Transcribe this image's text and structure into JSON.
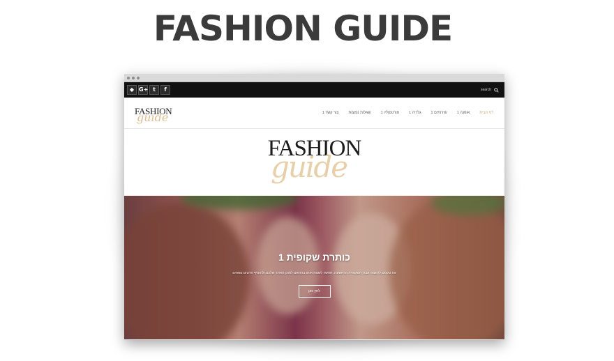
{
  "promo": {
    "title": "FASHION GUIDE"
  },
  "window": {
    "chrome_dots": 3
  },
  "topbar": {
    "social": [
      {
        "icon": "android-icon",
        "glyph": "◆"
      },
      {
        "icon": "google-plus-icon",
        "glyph": "G+"
      },
      {
        "icon": "twitter-icon",
        "glyph": "t"
      },
      {
        "icon": "facebook-icon",
        "glyph": "f"
      }
    ],
    "search_label": "search"
  },
  "nav": {
    "logo_top": "FASHION",
    "logo_bottom": "guide",
    "items": [
      {
        "label": "דף הבית",
        "active": true
      },
      {
        "label": "אופנה 1"
      },
      {
        "label": "שירותים 1"
      },
      {
        "label": "גלריה 1"
      },
      {
        "label": "פורטפוליו 1"
      },
      {
        "label": "שאלות נפוצות"
      },
      {
        "label": "צור קשר 1"
      }
    ]
  },
  "hero_logo": {
    "top": "FASHION",
    "bottom": "guide"
  },
  "hero": {
    "title": "כותרת שקופית 1",
    "subtitle": "זהו טקסט לדוגמה עבור השקופית הראשונה, אפשר לשנות אותו בהתאם לתוכן האתר שלכם ולהוסיף פרטים נוספים",
    "button": "לחץ כאן"
  },
  "colors": {
    "accent": "#c9a86a",
    "topbar": "#111111"
  }
}
